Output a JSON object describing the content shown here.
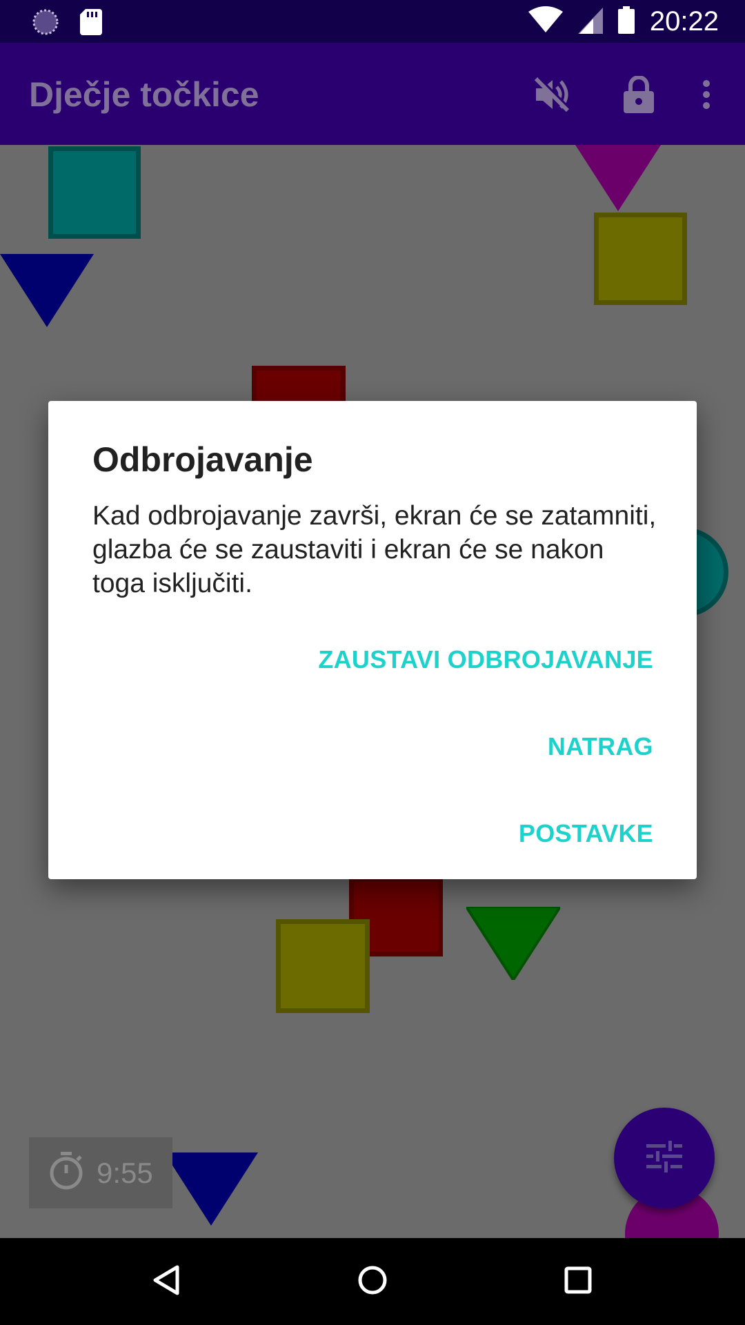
{
  "status_bar": {
    "time": "20:22",
    "icons": [
      "loading-indicator-icon",
      "sd-card-icon",
      "wifi-icon",
      "signal-icon",
      "battery-icon"
    ]
  },
  "app_bar": {
    "title": "Dječje točkice",
    "actions": [
      "volume-off-icon",
      "lock-icon",
      "more-vert-icon"
    ]
  },
  "timer": {
    "value": "9:55",
    "icon": "stopwatch-icon"
  },
  "fab": {
    "icon": "tune-sliders-icon"
  },
  "dialog": {
    "title": "Odbrojavanje",
    "message": "Kad odbrojavanje završi, ekran će se zatamniti, glazba će se zaustaviti i ekran će se nakon toga isključiti.",
    "buttons": {
      "stop_countdown": "ZAUSTAVI ODBROJAVANJE",
      "back": "NATRAG",
      "settings": "POSTAVKE"
    }
  },
  "nav_bar": {
    "icons": [
      "back-icon",
      "home-icon",
      "recents-icon"
    ]
  },
  "colors": {
    "app_bar": "#2a0070",
    "status_bar": "#13004a",
    "accent": "#1ed2cc",
    "canvas_dimmed": "#6b6b6b"
  }
}
